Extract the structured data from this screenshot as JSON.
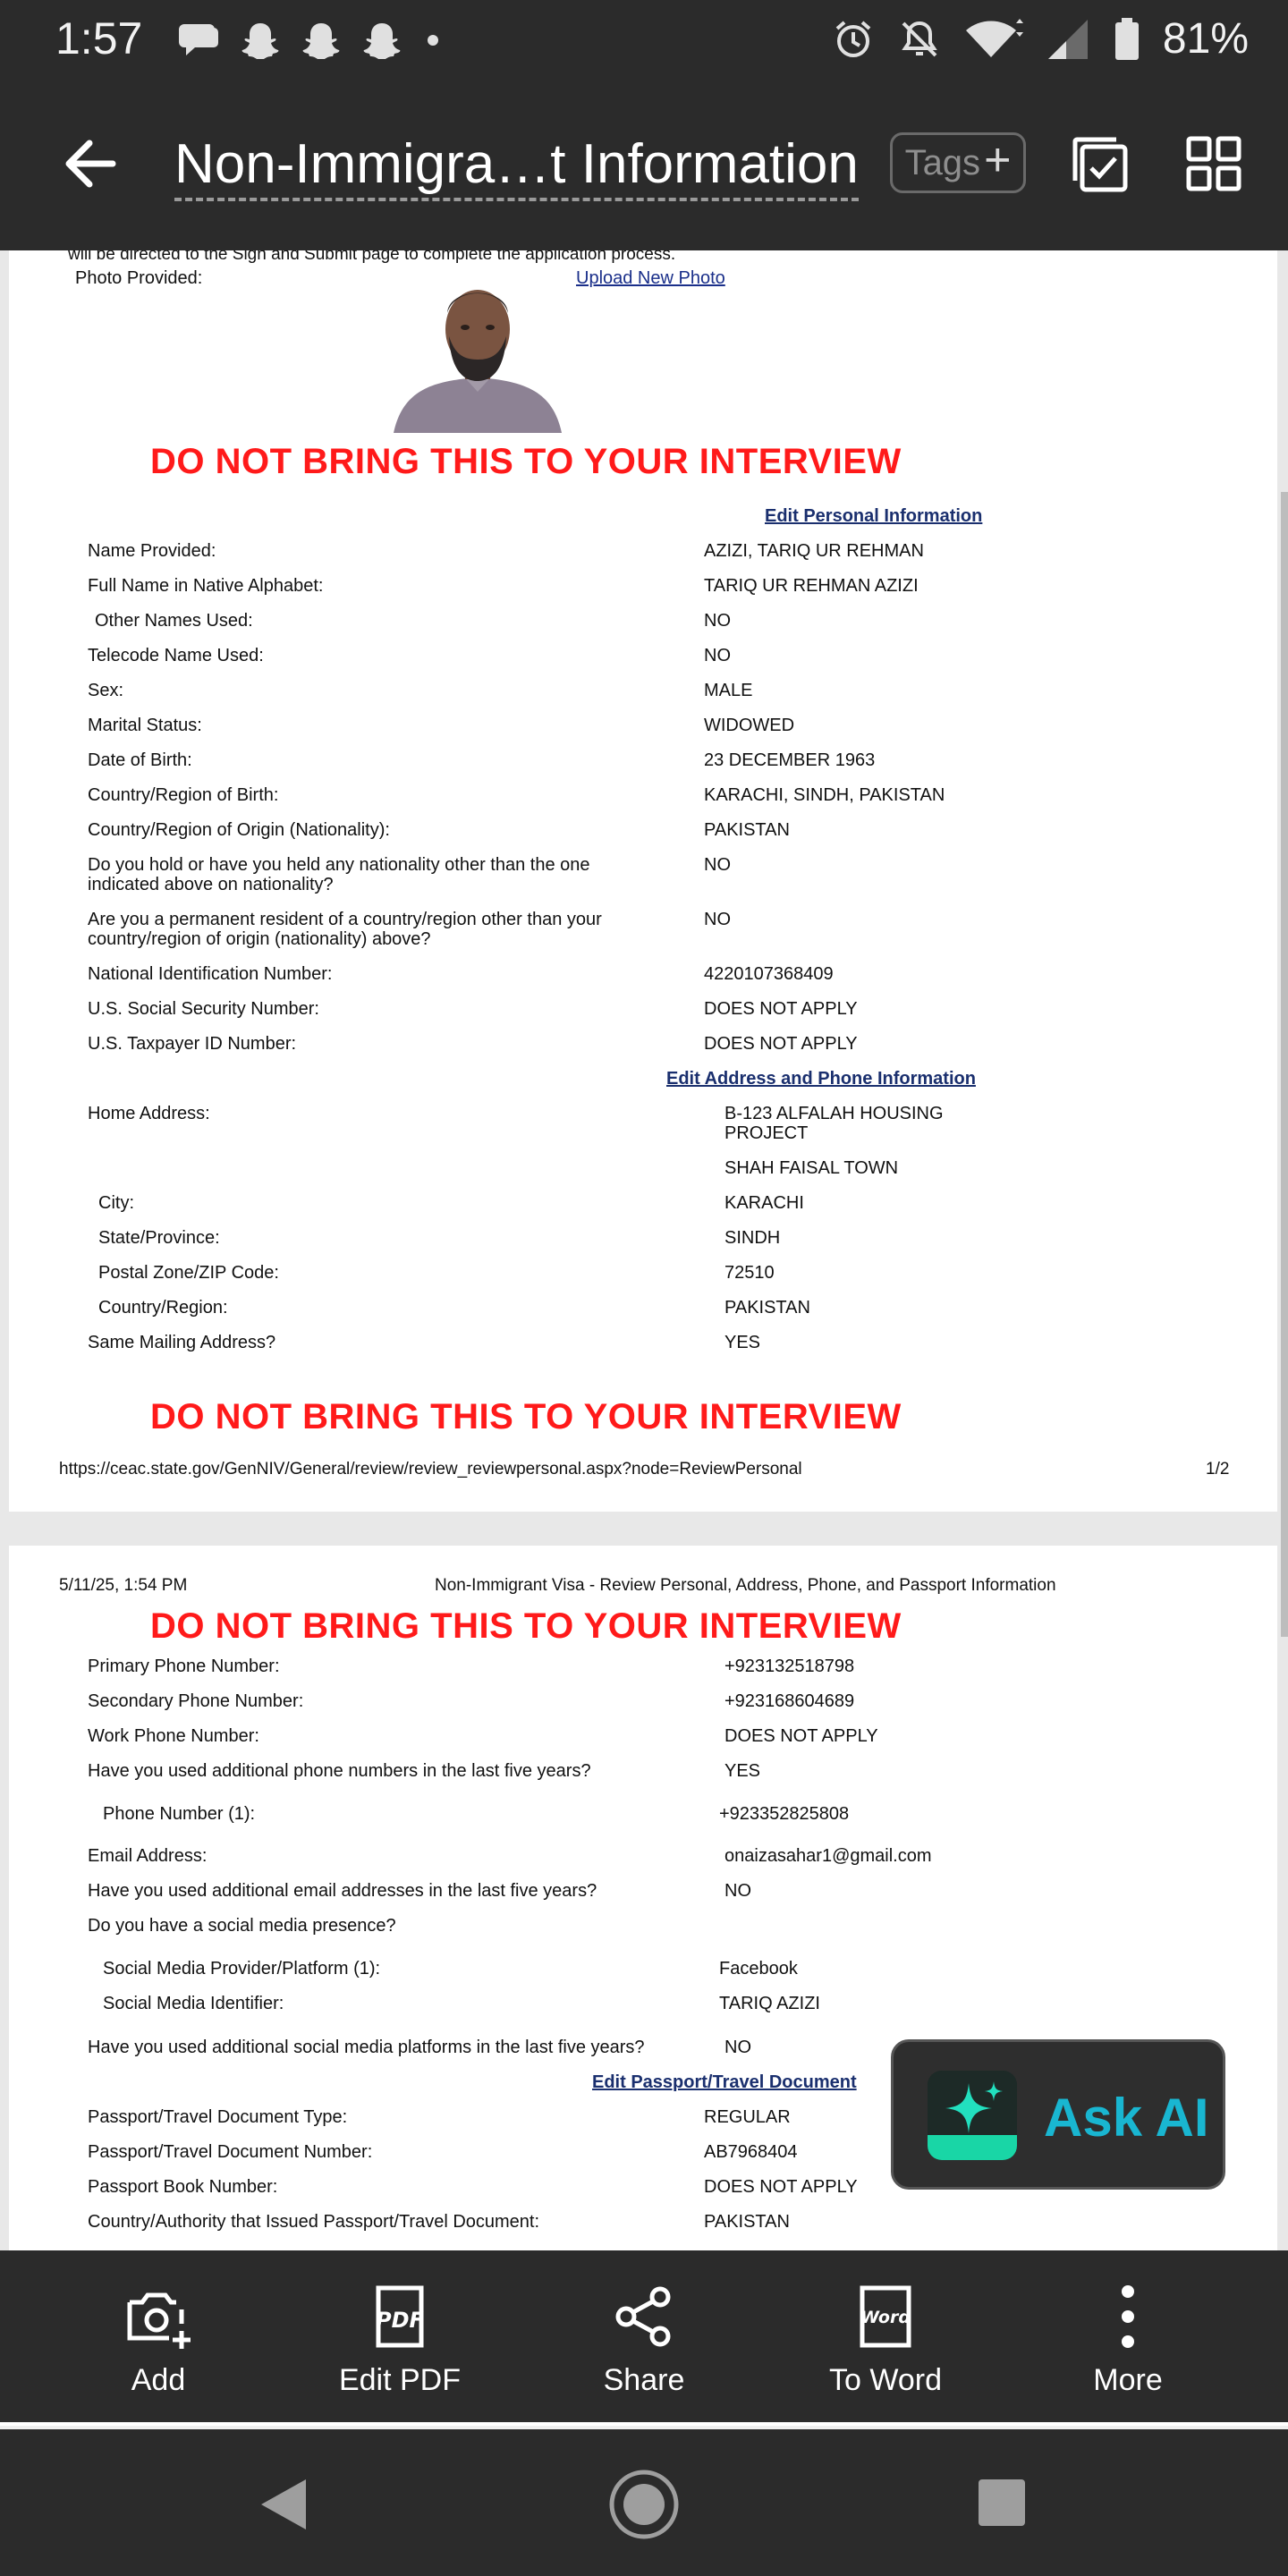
{
  "status_bar": {
    "time": "1:57",
    "battery": "81%",
    "icons": [
      "message-icon",
      "snapchat-icon",
      "snapchat-icon",
      "snapchat-icon",
      "dot-icon",
      "alarm-icon",
      "mute-icon",
      "wifi-icon",
      "signal-icon",
      "battery-icon"
    ]
  },
  "app_bar": {
    "title": "Non-Immigra…t Information",
    "tags_label": "Tags",
    "tags_plus": "+"
  },
  "page1": {
    "intro_line": "will be directed to the Sign and Submit page to complete the application process.",
    "photo_label": "Photo Provided:",
    "upload_link": "Upload New Photo",
    "warning": "DO NOT BRING THIS TO YOUR INTERVIEW",
    "edit_personal": "Edit Personal Information",
    "personal": [
      {
        "label": "Name Provided:",
        "value": "AZIZI, TARIQ UR REHMAN"
      },
      {
        "label": "Full Name in Native Alphabet:",
        "value": "TARIQ UR REHMAN AZIZI"
      },
      {
        "label": "Other Names Used:",
        "value": "NO"
      },
      {
        "label": "Telecode Name Used:",
        "value": "NO"
      },
      {
        "label": "Sex:",
        "value": "MALE"
      },
      {
        "label": "Marital Status:",
        "value": "WIDOWED"
      },
      {
        "label": "Date of Birth:",
        "value": "23 DECEMBER 1963"
      },
      {
        "label": "Country/Region of Birth:",
        "value": "KARACHI, SINDH, PAKISTAN"
      },
      {
        "label": "Country/Region of Origin (Nationality):",
        "value": "PAKISTAN"
      },
      {
        "label": "Do you hold or have you held any nationality other than the one indicated above on nationality?",
        "value": "NO"
      },
      {
        "label": "Are you a permanent resident of a country/region other than your country/region of origin (nationality) above?",
        "value": "NO"
      },
      {
        "label": "National Identification Number:",
        "value": "4220107368409"
      },
      {
        "label": "U.S. Social Security Number:",
        "value": "DOES NOT APPLY"
      },
      {
        "label": "U.S. Taxpayer ID Number:",
        "value": "DOES NOT APPLY"
      }
    ],
    "edit_address": "Edit Address and Phone Information",
    "address": [
      {
        "label": "Home Address:",
        "value": "B-123 ALFALAH HOUSING PROJECT"
      },
      {
        "label": "",
        "value": "SHAH FAISAL TOWN"
      },
      {
        "label": "City:",
        "value": "KARACHI"
      },
      {
        "label": "State/Province:",
        "value": "SINDH"
      },
      {
        "label": "Postal Zone/ZIP Code:",
        "value": "72510"
      },
      {
        "label": "Country/Region:",
        "value": "PAKISTAN"
      },
      {
        "label": "Same Mailing Address?",
        "value": "YES"
      }
    ],
    "footer_url": "https://ceac.state.gov/GenNIV/General/review/review_reviewpersonal.aspx?node=ReviewPersonal",
    "page_number": "1/2"
  },
  "page2": {
    "header_date": "5/11/25, 1:54 PM",
    "header_title": "Non-Immigrant Visa - Review Personal, Address, Phone, and Passport Information",
    "warning": "DO NOT BRING THIS TO YOUR INTERVIEW",
    "contact": [
      {
        "label": "Primary Phone Number:",
        "value": "+923132518798"
      },
      {
        "label": "Secondary Phone Number:",
        "value": "+923168604689"
      },
      {
        "label": "Work Phone Number:",
        "value": "DOES NOT APPLY"
      },
      {
        "label": "Have you used additional phone numbers in the last five years?",
        "value": "YES"
      },
      {
        "label": "Phone Number (1):",
        "value": "+923352825808"
      },
      {
        "label": "Email Address:",
        "value": "onaizasahar1@gmail.com"
      },
      {
        "label": "Have you used additional email addresses in the last five years?",
        "value": "NO"
      },
      {
        "label": "Do you have a social media presence?",
        "value": ""
      },
      {
        "label": "Social Media Provider/Platform (1):",
        "value": "Facebook"
      },
      {
        "label": "Social Media Identifier:",
        "value": "TARIQ AZIZI"
      },
      {
        "label": "Have you used additional social media platforms in the last five years?",
        "value": "NO"
      }
    ],
    "edit_passport": "Edit Passport/Travel Document",
    "passport": [
      {
        "label": "Passport/Travel Document Type:",
        "value": "REGULAR"
      },
      {
        "label": "Passport/Travel Document Number:",
        "value": "AB7968404"
      },
      {
        "label": "Passport Book Number:",
        "value": "DOES NOT APPLY"
      },
      {
        "label": "Country/Authority that Issued Passport/Travel Document:",
        "value": "PAKISTAN"
      }
    ]
  },
  "ask_ai": {
    "label": "Ask AI"
  },
  "toolbar": {
    "items": [
      {
        "label": "Add",
        "icon": "add-photo-icon"
      },
      {
        "label": "Edit PDF",
        "icon": "pdf-icon"
      },
      {
        "label": "Share",
        "icon": "share-icon"
      },
      {
        "label": "To Word",
        "icon": "word-icon"
      },
      {
        "label": "More",
        "icon": "more-vertical-icon"
      }
    ]
  },
  "navbar": {
    "icons": [
      "nav-back-icon",
      "nav-home-icon",
      "nav-recents-icon"
    ]
  }
}
